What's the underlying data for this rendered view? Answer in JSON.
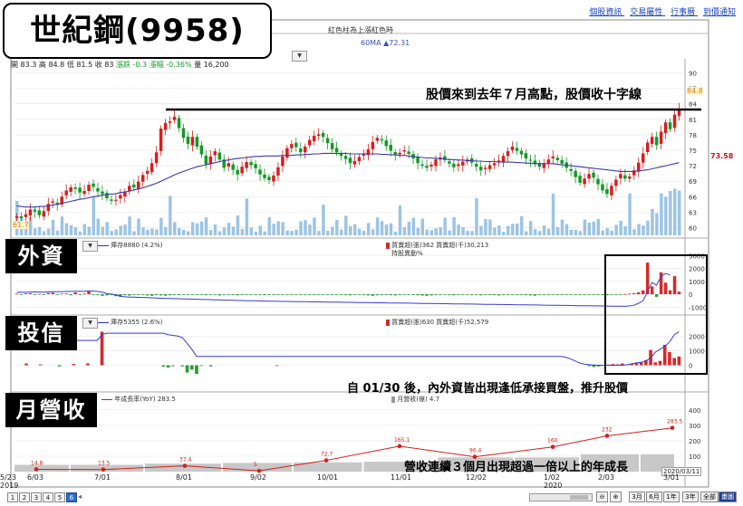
{
  "top_links": [
    "個股資訊",
    "交易屬性",
    "行事曆",
    "到價通知"
  ],
  "title": "世紀鋼(9958)",
  "subtitle": "紅色柱為上漲紅色時",
  "ma_legend": "60MA ▲72.31",
  "stock_bar": {
    "open": "開 83.3",
    "high": "高 84.8",
    "low": "低 81.5",
    "close": "收 83",
    "change": "漲跌 -0.3",
    "pct": "漲幅 -0.36%",
    "volume": "量 16,200"
  },
  "sections": {
    "foreign": "外資",
    "trust": "投信",
    "revenue": "月營收"
  },
  "legends": {
    "foreign_line": "庫存8880 (4.2%)",
    "foreign_bar": "買賣超(張)362 買賣超(千)30,213",
    "foreign_bar2": "持股異動%",
    "trust_line": "庫存5355 (2.6%)",
    "trust_bar": "買賣超(張)630 買賣超(千)52,579",
    "rev_line": "年成長率(YoY) 283.5",
    "rev_bar": "月營收(億) 4.7"
  },
  "annotations": {
    "top": "股價來到去年７月高點，股價收十字線",
    "mid": "自 01/30 後，內外資皆出現逢低承接買盤，推升股價",
    "bottom": "營收連續３個月出現超過一倍以上的年成長"
  },
  "price_labels": {
    "low_mark": "61.7",
    "high_mark": "84.8",
    "current": "73.58"
  },
  "date_end_label": "2020/03/11",
  "x_labels": [
    {
      "label": "5/23",
      "year": "2019"
    },
    {
      "label": "6/03",
      "year": ""
    },
    {
      "label": "7/01",
      "year": ""
    },
    {
      "label": "8/01",
      "year": ""
    },
    {
      "label": "9/02",
      "year": ""
    },
    {
      "label": "10/01",
      "year": ""
    },
    {
      "label": "11/01",
      "year": ""
    },
    {
      "label": "12/02",
      "year": ""
    },
    {
      "label": "1/02",
      "year": "2020"
    },
    {
      "label": "2/03",
      "year": ""
    },
    {
      "label": "3/01",
      "year": ""
    }
  ],
  "pages": [
    "1",
    "2",
    "3",
    "4",
    "5",
    "6"
  ],
  "active_page": "6",
  "time_buttons": [
    "3月",
    "6月",
    "1年",
    "3年",
    "全部",
    "畫圖"
  ],
  "chart_data": [
    {
      "type": "candlestick",
      "title": "",
      "y_ticks": [
        60,
        63,
        66,
        69,
        72,
        75,
        78,
        81,
        84,
        87,
        90
      ],
      "ylim": [
        58.5,
        91.5
      ],
      "close": [
        62.2,
        61.8,
        62.6,
        63.5,
        63.1,
        62.4,
        63.2,
        64.6,
        65.1,
        64.5,
        66.0,
        67.2,
        67.8,
        67.5,
        66.8,
        67.1,
        68.3,
        67.9,
        67.0,
        66.5,
        65.7,
        65.2,
        65.4,
        66.3,
        67.0,
        68.1,
        67.8,
        68.9,
        70.2,
        71.0,
        72.5,
        74.6,
        79.2,
        80.3,
        80.6,
        81.5,
        79.3,
        77.4,
        76.2,
        77.6,
        75.7,
        74.2,
        72.3,
        73.8,
        74.8,
        73.2,
        71.6,
        72.5,
        71.2,
        70.3,
        71.8,
        72.7,
        72.1,
        71.5,
        70.3,
        69.6,
        69.2,
        70.1,
        71.7,
        73.8,
        75.4,
        76.2,
        75.6,
        74.6,
        75.7,
        77.0,
        77.8,
        78.1,
        77.6,
        76.4,
        75.2,
        74.6,
        73.9,
        73.3,
        72.5,
        72.9,
        73.7,
        74.3,
        75.2,
        76.6,
        77.4,
        76.9,
        75.8,
        74.9,
        74.2,
        74.5,
        75.0,
        74.3,
        73.4,
        72.5,
        72.0,
        71.6,
        72.2,
        73.2,
        73.6,
        73.1,
        72.4,
        71.7,
        72.3,
        72.8,
        73.2,
        72.6,
        71.8,
        71.1,
        71.6,
        72.1,
        72.5,
        73.0,
        73.9,
        74.8,
        75.7,
        74.9,
        74.2,
        73.4,
        73.0,
        72.3,
        71.8,
        72.5,
        73.2,
        73.8,
        73.1,
        72.4,
        71.6,
        71.0,
        69.8,
        68.7,
        69.5,
        70.4,
        69.7,
        68.4,
        67.2,
        66.5,
        68.1,
        69.3,
        70.4,
        69.5,
        69.9,
        71.1,
        72.6,
        74.4,
        76.5,
        77.6,
        76.0,
        78.6,
        80.4,
        79.1,
        81.9,
        83.0
      ],
      "ma": [
        64.2,
        64.1,
        64.0,
        64.0,
        64.0,
        64.1,
        64.1,
        64.2,
        64.4,
        64.5,
        64.7,
        64.9,
        65.1,
        65.3,
        65.5,
        65.6,
        65.8,
        66.0,
        66.1,
        66.3,
        66.4,
        66.5,
        66.6,
        66.8,
        66.9,
        67.1,
        67.3,
        67.5,
        67.7,
        68.0,
        68.3,
        68.6,
        69.0,
        69.4,
        69.8,
        70.2,
        70.6,
        70.9,
        71.2,
        71.5,
        71.8,
        72.0,
        72.2,
        72.4,
        72.6,
        72.8,
        73.0,
        73.1,
        73.3,
        73.4,
        73.5,
        73.6,
        73.7,
        73.8,
        73.8,
        73.9,
        73.9,
        73.9,
        73.9,
        74.0,
        74.0,
        74.0,
        74.1,
        74.1,
        74.2,
        74.2,
        74.3,
        74.3,
        74.4,
        74.4,
        74.4,
        74.4,
        74.4,
        74.4,
        74.3,
        74.3,
        74.3,
        74.3,
        74.3,
        74.3,
        74.3,
        74.2,
        74.2,
        74.1,
        74.1,
        74.0,
        74.0,
        73.9,
        73.8,
        73.7,
        73.6,
        73.5,
        73.5,
        73.4,
        73.4,
        73.3,
        73.2,
        73.2,
        73.1,
        73.1,
        73.0,
        73.0,
        72.9,
        72.9,
        72.8,
        72.8,
        72.8,
        72.7,
        72.7,
        72.7,
        72.7,
        72.6,
        72.6,
        72.5,
        72.5,
        72.4,
        72.4,
        72.4,
        72.4,
        72.4,
        72.3,
        72.2,
        72.1,
        72.0,
        71.9,
        71.8,
        71.7,
        71.6,
        71.5,
        71.4,
        71.3,
        71.2,
        71.1,
        71.0,
        70.9,
        70.9,
        70.9,
        70.9,
        71.0,
        71.1,
        71.2,
        71.4,
        71.6,
        71.8,
        72.0,
        72.2,
        72.4,
        72.6
      ]
    },
    {
      "type": "bar",
      "title": "",
      "y_ticks": [
        -1000,
        0,
        1000,
        2000,
        3000
      ],
      "ylim": [
        -1400,
        3300
      ],
      "values": [
        40,
        -20,
        60,
        80,
        -40,
        30,
        -60,
        90,
        120,
        -30,
        50,
        60,
        -80,
        140,
        -20,
        40,
        210,
        -60,
        -40,
        -120,
        -90,
        -60,
        -150,
        -200,
        -80,
        -100,
        -30,
        -40,
        -60,
        -90,
        -120,
        -70,
        -90,
        -110,
        -80,
        -60,
        -70,
        -50,
        -40,
        -60,
        -30,
        -50,
        -70,
        -40,
        -20,
        -90,
        -50,
        -30,
        -60,
        -80,
        -40,
        -20,
        -30,
        -60,
        -50,
        -70,
        -40,
        -60,
        -30,
        -20,
        -40,
        -30,
        -50,
        -60,
        -20,
        -40,
        -30,
        -10,
        -20,
        -40,
        -30,
        -20,
        -40,
        -60,
        -80,
        -50,
        -30,
        -60,
        -90,
        -120,
        -80,
        -60,
        -40,
        -70,
        -90,
        -60,
        -40,
        -20,
        -60,
        -80,
        -100,
        -120,
        -90,
        -60,
        -40,
        -30,
        -60,
        -80,
        -50,
        -40,
        -30,
        -20,
        -60,
        -80,
        -50,
        -40,
        -70,
        -90,
        -60,
        -40,
        -20,
        -30,
        -50,
        -70,
        -90,
        -110,
        -60,
        -40,
        -30,
        -20,
        -10,
        -30,
        -50,
        -40,
        -30,
        -20,
        -60,
        -40,
        -20,
        -40,
        -60,
        -80,
        -40,
        -20,
        -10,
        20,
        40,
        80,
        150,
        300,
        2450,
        600,
        -200,
        1700,
        900,
        300,
        1400,
        200
      ],
      "line": [
        150,
        160,
        150,
        170,
        180,
        170,
        160,
        180,
        200,
        190,
        200,
        220,
        210,
        230,
        230,
        220,
        260,
        240,
        210,
        150,
        60,
        10,
        -60,
        -150,
        -200,
        -220,
        -230,
        -240,
        -250,
        -260,
        -280,
        -300,
        -310,
        -320,
        -330,
        -340,
        -350,
        -360,
        -370,
        -380,
        -390,
        -400,
        -410,
        -420,
        -430,
        -440,
        -450,
        -460,
        -470,
        -480,
        -490,
        -500,
        -505,
        -510,
        -520,
        -530,
        -540,
        -545,
        -550,
        -555,
        -560,
        -565,
        -570,
        -575,
        -580,
        -585,
        -590,
        -595,
        -600,
        -605,
        -610,
        -615,
        -620,
        -625,
        -630,
        -635,
        -640,
        -645,
        -650,
        -655,
        -660,
        -665,
        -670,
        -675,
        -680,
        -685,
        -690,
        -695,
        -700,
        -705,
        -710,
        -715,
        -720,
        -725,
        -730,
        -735,
        -740,
        -745,
        -750,
        -755,
        -760,
        -765,
        -770,
        -775,
        -780,
        -785,
        -790,
        -795,
        -800,
        -805,
        -810,
        -815,
        -820,
        -825,
        -830,
        -835,
        -840,
        -845,
        -850,
        -855,
        -860,
        -865,
        -870,
        -875,
        -880,
        -885,
        -890,
        -895,
        -900,
        -905,
        -910,
        -915,
        -920,
        -925,
        -930,
        -935,
        -900,
        -850,
        -700,
        -500,
        200,
        900,
        700,
        1400,
        1600,
        1500
      ]
    },
    {
      "type": "bar",
      "title": "",
      "y_ticks": [
        0,
        1000,
        2000
      ],
      "ylim": [
        -900,
        2700
      ],
      "values": [
        0,
        0,
        120,
        0,
        0,
        60,
        0,
        0,
        0,
        -80,
        0,
        0,
        90,
        0,
        0,
        130,
        0,
        0,
        2300,
        0,
        0,
        0,
        0,
        0,
        0,
        0,
        0,
        0,
        0,
        0,
        0,
        -90,
        -150,
        -60,
        0,
        -70,
        -500,
        -300,
        -600,
        -40,
        0,
        -80,
        0,
        0,
        0,
        0,
        0,
        0,
        0,
        0,
        0,
        0,
        0,
        0,
        0,
        -40,
        0,
        0,
        0,
        0,
        0,
        0,
        0,
        0,
        0,
        0,
        0,
        0,
        0,
        0,
        0,
        0,
        0,
        0,
        0,
        0,
        0,
        0,
        0,
        0,
        0,
        0,
        0,
        0,
        0,
        0,
        0,
        0,
        0,
        0,
        0,
        0,
        0,
        0,
        0,
        0,
        0,
        0,
        0,
        0,
        0,
        0,
        0,
        0,
        0,
        0,
        0,
        0,
        0,
        0,
        0,
        0,
        0,
        0,
        0,
        0,
        0,
        0,
        0,
        0,
        0,
        -60,
        -120,
        -80,
        0,
        40,
        80,
        60,
        120,
        50,
        100,
        150,
        200,
        350,
        1050,
        200,
        300,
        1400,
        900,
        500,
        600
      ],
      "line": [
        1700,
        1700,
        1700,
        1700,
        1700,
        1700,
        1700,
        1700,
        1700,
        1700,
        1700,
        1700,
        1700,
        1700,
        1700,
        1700,
        1700,
        1700,
        2100,
        2200,
        2200,
        2200,
        2200,
        2200,
        2200,
        2200,
        2200,
        2200,
        2200,
        2200,
        2200,
        2200,
        2100,
        2050,
        2000,
        1900,
        1500,
        1100,
        600,
        600,
        600,
        600,
        600,
        600,
        600,
        600,
        600,
        600,
        600,
        600,
        600,
        600,
        600,
        600,
        600,
        600,
        600,
        600,
        600,
        600,
        600,
        600,
        600,
        600,
        600,
        600,
        600,
        600,
        600,
        600,
        600,
        600,
        600,
        600,
        600,
        600,
        600,
        600,
        600,
        600,
        600,
        600,
        600,
        600,
        600,
        600,
        600,
        600,
        600,
        600,
        600,
        600,
        600,
        600,
        600,
        600,
        600,
        600,
        600,
        600,
        600,
        600,
        600,
        600,
        600,
        600,
        600,
        600,
        600,
        600,
        600,
        600,
        600,
        600,
        600,
        600,
        550,
        450,
        300,
        150,
        80,
        40,
        20,
        0,
        0,
        0,
        0,
        0,
        0,
        40,
        100,
        160,
        200,
        300,
        500,
        900,
        1100,
        1300,
        1600,
        2100,
        2300
      ]
    },
    {
      "type": "bar",
      "title": "",
      "categories": [
        "6/03",
        "7/01",
        "8/01",
        "9/02",
        "10/01",
        "11/01",
        "12/02",
        "1/02",
        "2/03",
        "3/01"
      ],
      "y_ticks": [
        0,
        100,
        200,
        300,
        400
      ],
      "ylim": [
        0,
        440
      ],
      "values": [
        5.5,
        5.5,
        6.5,
        7.0,
        7.5,
        8.0,
        11.5,
        11.5,
        14.0,
        14.0
      ],
      "yoy": [
        14.8,
        13.5,
        37.4,
        5,
        72.7,
        165.1,
        96.4,
        160,
        232,
        283.5
      ],
      "yoy_labels": [
        "14.8",
        "13.5",
        "37.4",
        "5",
        "72.7",
        "165.1",
        "96.4",
        "160",
        "232",
        "283.5"
      ]
    }
  ]
}
